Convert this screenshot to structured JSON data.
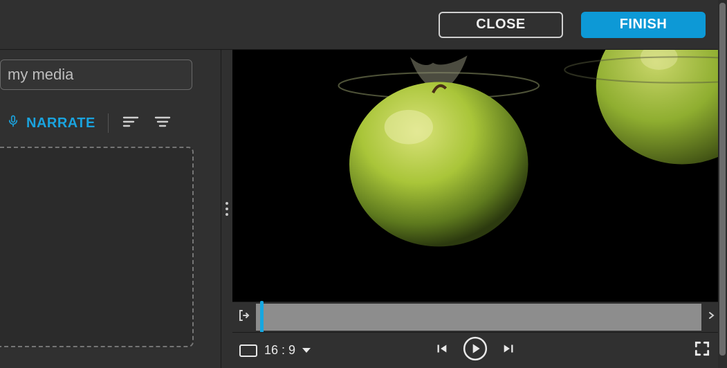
{
  "header": {
    "close_label": "CLOSE",
    "finish_label": "FINISH"
  },
  "sidebar": {
    "search_placeholder": "my media",
    "narrate_label": "NARRATE",
    "dropzone_hint": ""
  },
  "player": {
    "aspect_label": "16 : 9"
  },
  "colors": {
    "accent": "#0d99d6"
  }
}
